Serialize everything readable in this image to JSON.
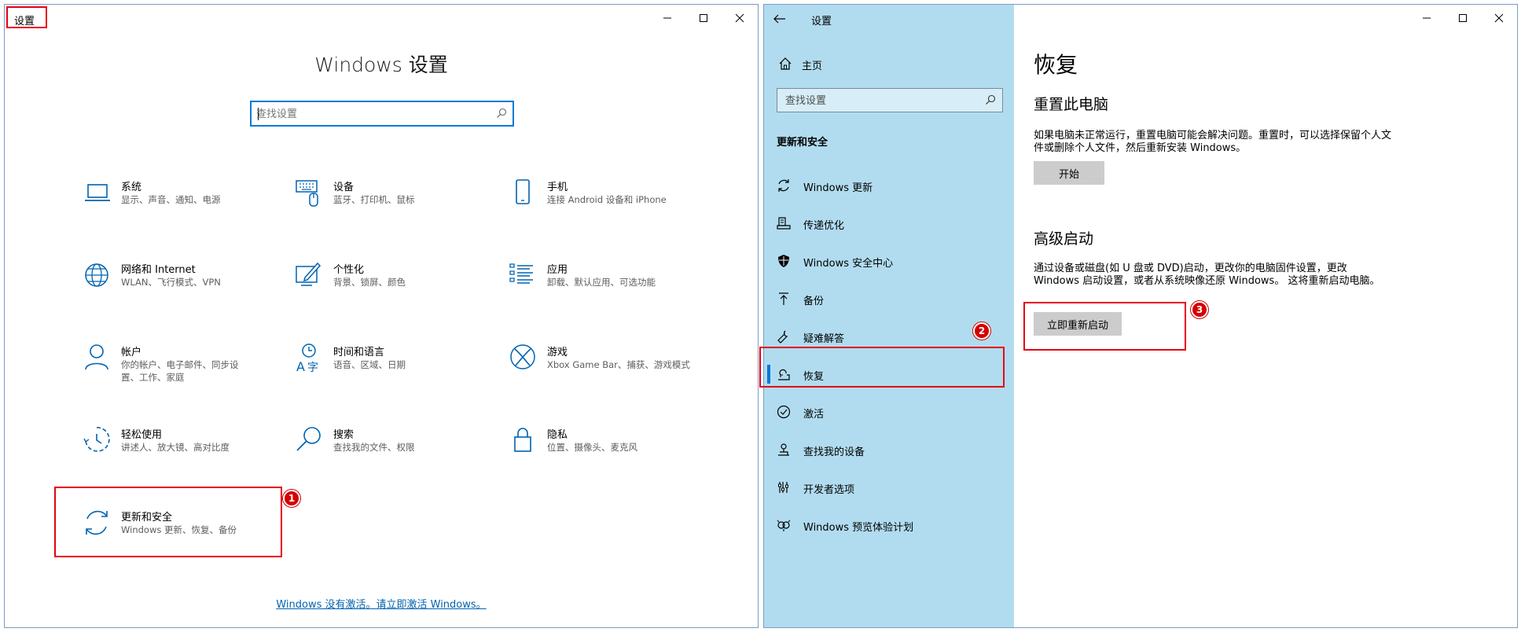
{
  "left_window": {
    "title": "设置",
    "heading": "Windows 设置",
    "search_placeholder": "查找设置",
    "tiles": [
      {
        "name": "系统",
        "desc": "显示、声音、通知、电源",
        "icon": "laptop-icon"
      },
      {
        "name": "设备",
        "desc": "蓝牙、打印机、鼠标",
        "icon": "keyboard-icon"
      },
      {
        "name": "手机",
        "desc": "连接 Android 设备和 iPhone",
        "icon": "phone-icon"
      },
      {
        "name": "网络和 Internet",
        "desc": "WLAN、飞行模式、VPN",
        "icon": "globe-icon"
      },
      {
        "name": "个性化",
        "desc": "背景、锁屏、颜色",
        "icon": "paint-pen-icon"
      },
      {
        "name": "应用",
        "desc": "卸载、默认应用、可选功能",
        "icon": "app-list-icon"
      },
      {
        "name": "帐户",
        "desc": "你的帐户、电子邮件、同步设置、工作、家庭",
        "icon": "person-icon"
      },
      {
        "name": "时间和语言",
        "desc": "语音、区域、日期",
        "icon": "time-language-icon"
      },
      {
        "name": "游戏",
        "desc": "Xbox Game Bar、捕获、游戏模式",
        "icon": "xbox-icon"
      },
      {
        "name": "轻松使用",
        "desc": "讲述人、放大镜、高对比度",
        "icon": "ease-of-access-icon"
      },
      {
        "name": "搜索",
        "desc": "查找我的文件、权限",
        "icon": "magnifier-icon"
      },
      {
        "name": "隐私",
        "desc": "位置、摄像头、麦克风",
        "icon": "lock-icon"
      },
      {
        "name": "更新和安全",
        "desc": "Windows 更新、恢复、备份",
        "icon": "sync-icon"
      }
    ],
    "activation_link": "Windows 没有激活。请立即激活 Windows。"
  },
  "right_window": {
    "title": "设置",
    "home_label": "主页",
    "search_placeholder": "查找设置",
    "section_label": "更新和安全",
    "nav_items": [
      {
        "label": "Windows 更新",
        "icon": "sync-icon"
      },
      {
        "label": "传递优化",
        "icon": "delivery-icon"
      },
      {
        "label": "Windows 安全中心",
        "icon": "shield-icon"
      },
      {
        "label": "备份",
        "icon": "backup-arrow-icon"
      },
      {
        "label": "疑难解答",
        "icon": "wrench-icon"
      },
      {
        "label": "恢复",
        "icon": "recovery-icon"
      },
      {
        "label": "激活",
        "icon": "check-circle-icon"
      },
      {
        "label": "查找我的设备",
        "icon": "find-device-icon"
      },
      {
        "label": "开发者选项",
        "icon": "developer-icon"
      },
      {
        "label": "Windows 预览体验计划",
        "icon": "insider-icon"
      }
    ],
    "selected_nav": "恢复",
    "page_title": "恢复",
    "reset": {
      "title": "重置此电脑",
      "desc": "如果电脑未正常运行，重置电脑可能会解决问题。重置时，可以选择保留个人文件或删除个人文件，然后重新安装 Windows。",
      "button": "开始"
    },
    "advanced": {
      "title": "高级启动",
      "desc": "通过设备或磁盘(如 U 盘或 DVD)启动，更改你的电脑固件设置，更改 Windows 启动设置，或者从系统映像还原 Windows。 这将重新启动电脑。",
      "button": "立即重新启动"
    }
  },
  "annotations": {
    "badge1": "1",
    "badge2": "2",
    "badge3": "3"
  },
  "colors": {
    "accent": "#0078d7",
    "sidebar_bg": "#b1dcef",
    "highlight": "#e60012",
    "link": "#0063b1"
  }
}
